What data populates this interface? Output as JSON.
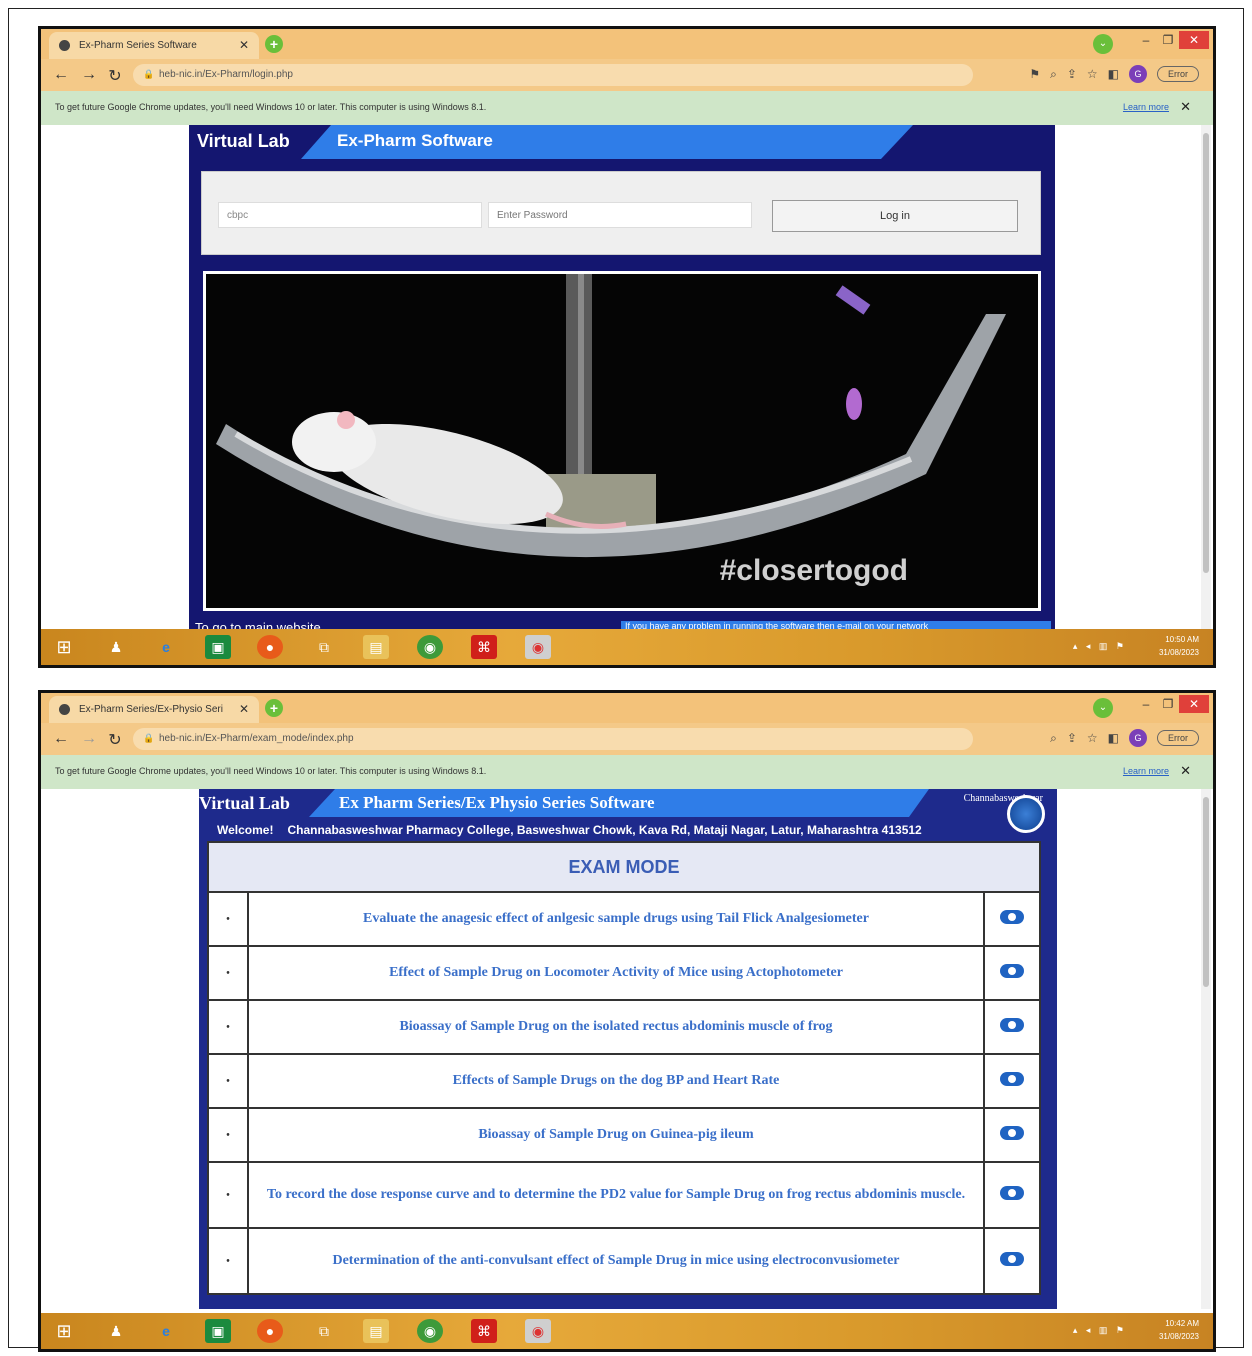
{
  "screen1": {
    "tab_title": "Ex-Pharm Series Software",
    "url": "heb-nic.in/Ex-Pharm/login.php",
    "error_pill": "Error",
    "infobar_text": "To get future Google Chrome updates, you'll need Windows 10 or later. This computer is using Windows 8.1.",
    "infobar_link": "Learn more",
    "site_title": "Virtual Lab",
    "software_title": "Ex-Pharm Software",
    "username_value": "cbpc",
    "password_placeholder": "Enter Password",
    "login_button": "Log in",
    "photo_caption": "#closertogod",
    "footer_link": "To go to main website",
    "ticker_text": "If you have any problem in running the software then e-mail on your network",
    "clock_time": "10:50 AM",
    "clock_date": "31/08/2023"
  },
  "screen2": {
    "tab_title": "Ex-Pharm Series/Ex-Physio Seri",
    "url": "heb-nic.in/Ex-Pharm/exam_mode/index.php",
    "error_pill": "Error",
    "infobar_text": "To get future Google Chrome updates, you'll need Windows 10 or later. This computer is using Windows 8.1.",
    "infobar_link": "Learn more",
    "site_title": "Virtual Lab",
    "software_title": "Ex Pharm Series/Ex Physio Series Software",
    "corner_text": "Channabasweshwar",
    "welcome_label": "Welcome!",
    "college": "Channabasweshwar Pharmacy College, Basweshwar Chowk, Kava Rd, Mataji Nagar, Latur, Maharashtra 413512",
    "exam_mode_heading": "EXAM MODE",
    "bullet": "•",
    "experiments": [
      "Evaluate the anagesic effect of anlgesic sample drugs using Tail Flick Analgesiometer",
      "Effect of Sample Drug on Locomoter Activity of Mice using Actophotometer",
      "Bioassay of Sample Drug on the isolated rectus abdominis muscle of frog",
      "Effects of Sample Drugs on the dog BP and Heart Rate",
      "Bioassay of Sample Drug on Guinea-pig ileum",
      "To record the dose response curve and to determine the PD2 value for Sample Drug on frog rectus abdominis muscle.",
      "Determination of the anti-convulsant effect of Sample Drug in mice using electroconvusiometer"
    ],
    "clock_time": "10:42 AM",
    "clock_date": "31/08/2023"
  },
  "colors": {
    "chrome_tab_strip": "#f3c27a",
    "infobar": "#cfe6c8",
    "panel_navy": "#141670",
    "accent_blue": "#2f7de8",
    "link_blue": "#3a6fc9"
  },
  "icons": {
    "back": "back-arrow-icon",
    "forward": "forward-arrow-icon",
    "reload": "reload-icon",
    "start": "windows-start-icon",
    "go": "go-button-icon"
  }
}
